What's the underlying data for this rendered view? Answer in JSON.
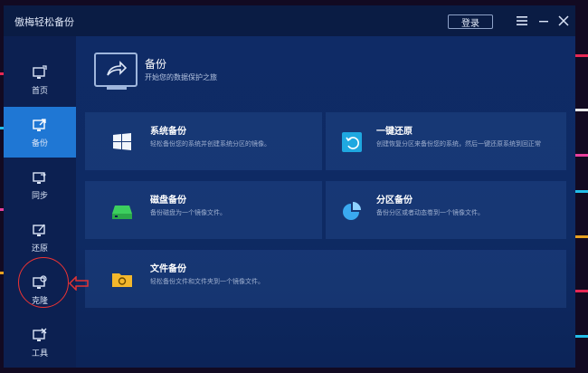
{
  "window": {
    "title": "傲梅轻松备份",
    "login_label": "登录",
    "menu_icon": "menu-icon",
    "minimize_icon": "minimize-icon",
    "close_icon": "close-icon"
  },
  "sidebar": {
    "items": [
      {
        "label": "首页",
        "icon": "home-icon",
        "active": false
      },
      {
        "label": "备份",
        "icon": "backup-icon",
        "active": true
      },
      {
        "label": "同步",
        "icon": "sync-icon",
        "active": false
      },
      {
        "label": "还原",
        "icon": "restore-icon",
        "active": false
      },
      {
        "label": "克隆",
        "icon": "clone-icon",
        "active": false
      },
      {
        "label": "工具",
        "icon": "tools-icon",
        "active": false
      }
    ]
  },
  "main": {
    "header": {
      "title": "备份",
      "subtitle": "开始您的数据保护之旅"
    },
    "cards": [
      {
        "title": "系统备份",
        "desc": "轻松备份您的系统并创建系统分区的镜像。",
        "icon": "windows-icon"
      },
      {
        "title": "一键还原",
        "desc": "创建恢复分区来备份您的系统，然后一键还原系统到回正常",
        "icon": "restore-button-icon"
      },
      {
        "title": "磁盘备份",
        "desc": "备份磁盘为一个镜像文件。",
        "icon": "disk-icon"
      },
      {
        "title": "分区备份",
        "desc": "备份分区或者动态卷到一个镜像文件。",
        "icon": "partition-icon"
      },
      {
        "title": "文件备份",
        "desc": "轻松备份文件和文件夹到一个镜像文件。",
        "icon": "folder-icon"
      }
    ]
  },
  "colors": {
    "accent": "#1f77d4",
    "sidebar_bg": "#0c2051",
    "main_bg": "#0f2b66",
    "annotation_red": "#e33333"
  }
}
